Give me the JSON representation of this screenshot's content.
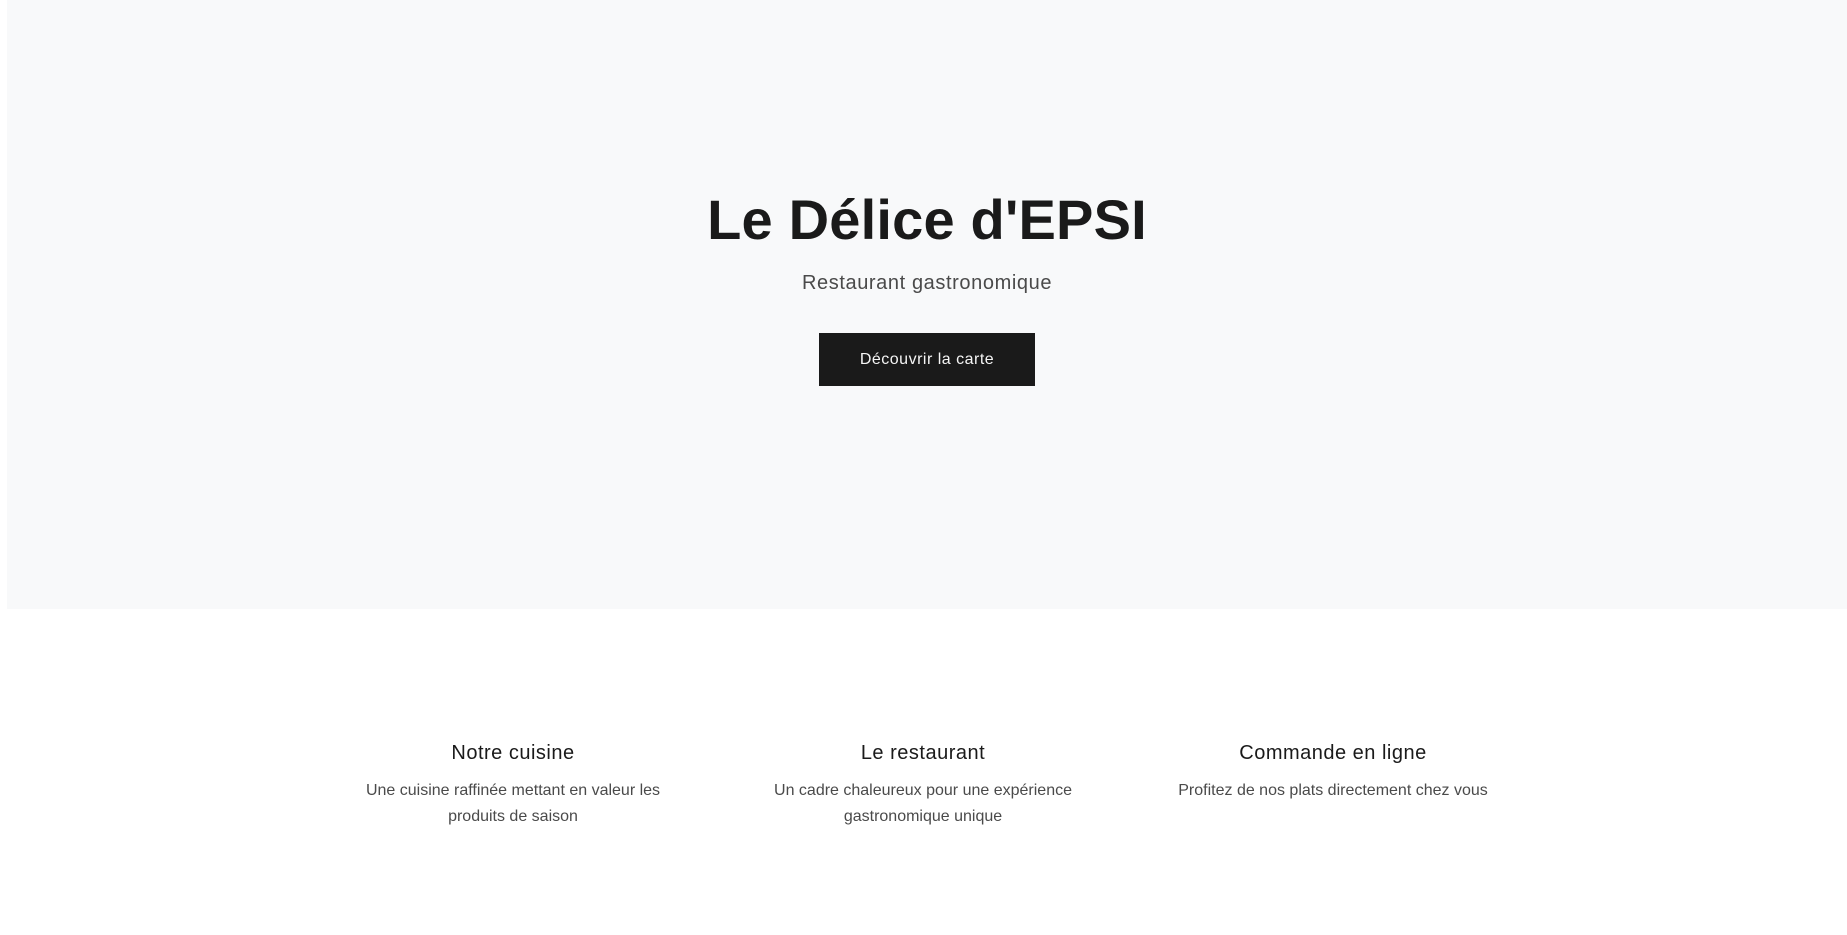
{
  "hero": {
    "title": "Le Délice d'EPSI",
    "subtitle": "Restaurant gastronomique",
    "cta_label": "Découvrir la carte"
  },
  "features": [
    {
      "title": "Notre cuisine",
      "text": "Une cuisine raffinée mettant en valeur les produits de saison"
    },
    {
      "title": "Le restaurant",
      "text": "Un cadre chaleureux pour une expérience gastronomique unique"
    },
    {
      "title": "Commande en ligne",
      "text": "Profitez de nos plats directement chez vous"
    }
  ],
  "colors": {
    "hero_background": "#f8f9fa",
    "button_background": "#1a1a1a",
    "text_primary": "#1a1a1a",
    "text_secondary": "#4a4a4a"
  }
}
